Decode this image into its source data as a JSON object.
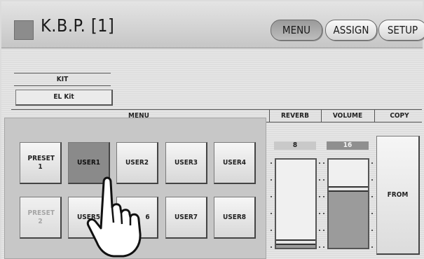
{
  "header": {
    "title": "K.B.P. [1]",
    "buttons": [
      {
        "label": "MENU",
        "active": true
      },
      {
        "label": "ASSIGN",
        "active": false
      },
      {
        "label": "SETUP",
        "active": false
      }
    ]
  },
  "kit": {
    "heading": "KIT",
    "value": "EL Kit"
  },
  "sections": {
    "menu": "MENU",
    "reverb": "REVERB",
    "volume": "VOLUME",
    "copy": "COPY"
  },
  "pads": {
    "row1": [
      {
        "label": "PRESET 1",
        "state": "normal"
      },
      {
        "label": "USER1",
        "state": "selected"
      },
      {
        "label": "USER2",
        "state": "normal"
      },
      {
        "label": "USER3",
        "state": "normal"
      },
      {
        "label": "USER4",
        "state": "normal"
      }
    ],
    "row2": [
      {
        "label": "PRESET 2",
        "state": "disabled"
      },
      {
        "label": "USER5",
        "state": "normal"
      },
      {
        "label": "USER6",
        "visible_text": "6",
        "state": "normal"
      },
      {
        "label": "USER7",
        "state": "normal"
      },
      {
        "label": "USER8",
        "state": "normal"
      }
    ]
  },
  "reverb": {
    "value": "8",
    "max": 127,
    "level": 8
  },
  "volume": {
    "value": "16",
    "max": 24,
    "level": 16
  },
  "copy": {
    "from_label": "FROM"
  },
  "colors": {
    "background": "#dcdcdc",
    "selected_pad": "#8a8a8a",
    "disabled_text": "#a5a5a5",
    "slider_fill": "#9b9b9b"
  }
}
